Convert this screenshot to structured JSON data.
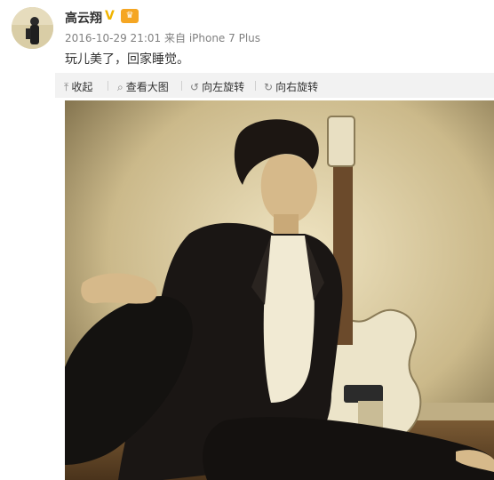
{
  "post": {
    "username": "高云翔",
    "verified_badge": "V",
    "member_icon": "crown-icon",
    "timestamp": "2016-10-29 21:01",
    "source_prefix": "来自",
    "source_device": "iPhone 7 Plus",
    "text": "玩儿美了，回家睡觉。"
  },
  "toolbar": {
    "collapse_label": "收起",
    "view_large_label": "查看大图",
    "rotate_left_label": "向左旋转",
    "rotate_right_label": "向右旋转"
  },
  "colors": {
    "username": "#333333",
    "meta": "#808080",
    "verified": "#f0b400",
    "toolbar_bg": "#f2f2f2",
    "photo_tone": "#e0d2a6"
  }
}
